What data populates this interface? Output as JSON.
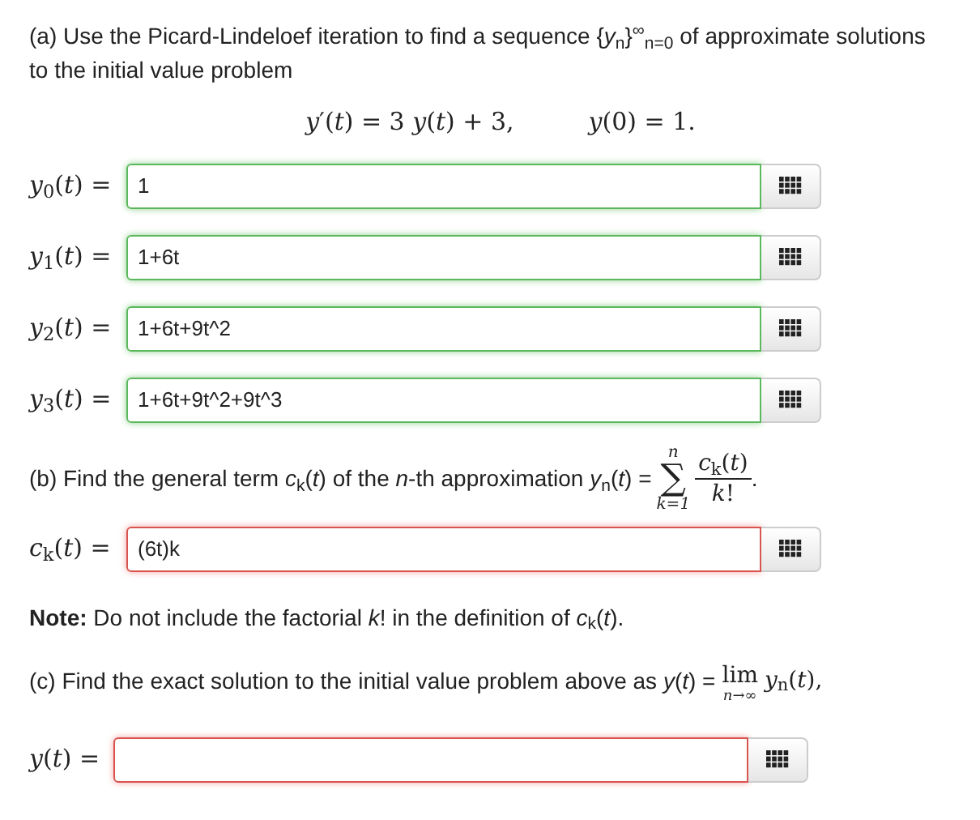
{
  "part_a": {
    "text": "(a) Use the Picard-Lindeloef iteration to find a sequence {*y*$_{n}$}$^{∞}$$_{n=0}$ of approximate solutions to the initial value problem",
    "equation": "*y*′(*t*) = 3 *y*(*t*) + 3,",
    "condition": "*y*(0) = 1."
  },
  "answers_a": [
    {
      "label": "*y*$_{0}$(*t*) =",
      "value": "1",
      "correct": true
    },
    {
      "label": "*y*$_{1}$(*t*) =",
      "value": "1+6t",
      "correct": true
    },
    {
      "label": "*y*$_{2}$(*t*) =",
      "value": "1+6t+9t^2",
      "correct": true
    },
    {
      "label": "*y*$_{3}$(*t*) =",
      "value": "1+6t+9t^2+9t^3",
      "correct": true
    }
  ],
  "part_b": {
    "text": "(b) Find the general term *c*$_{k}$(*t*) of the *n*-th approximation *y*$_{n}$(*t*) =",
    "sum_upper": "n",
    "sum_symbol": "∑",
    "sum_lower": "k=1",
    "numerator": "*c*$_{k}$(*t*)",
    "denominator": "*k*!",
    "end": "."
  },
  "answers_b": [
    {
      "label": "*c*$_{k}$(*t*) =",
      "value": "(6t)k",
      "correct": false
    }
  ],
  "note": "**Note:** Do not include the factorial *k*! in the definition of *c*$_{k}$(*t*).",
  "part_c": {
    "text": "(c) Find the exact solution to the initial value problem above as *y*(*t*) =",
    "lim": "lim",
    "lim_under": "n→∞",
    "after": "*y*$_{n}$(*t*),"
  },
  "answers_c": [
    {
      "label": "*y*(*t*) =",
      "correct": false
    }
  ]
}
